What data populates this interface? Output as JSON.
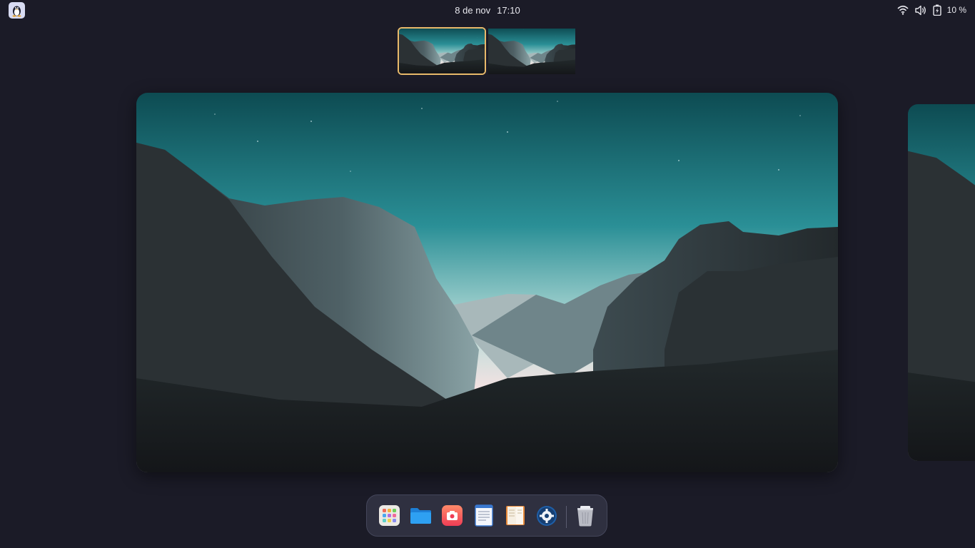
{
  "panel": {
    "distro_icon": "linux-penguin-icon",
    "date": "8 de nov",
    "time": "17:10",
    "tray": {
      "wifi_icon": "wifi-icon",
      "volume_icon": "volume-icon",
      "battery_icon": "battery-charging-icon",
      "battery_percent": "10 %"
    }
  },
  "workspaces": {
    "count": 2,
    "active_index": 0,
    "thumbnails": [
      {
        "name": "workspace-1",
        "active": true
      },
      {
        "name": "workspace-2",
        "active": false
      }
    ]
  },
  "dock": {
    "apps": [
      {
        "name": "app-grid",
        "icon": "app-grid-icon"
      },
      {
        "name": "files",
        "icon": "folder-icon"
      },
      {
        "name": "screenshot",
        "icon": "camera-icon"
      },
      {
        "name": "text-editor",
        "icon": "document-icon"
      },
      {
        "name": "reader",
        "icon": "book-icon"
      },
      {
        "name": "settings",
        "icon": "settings-gear-icon"
      }
    ],
    "trash_icon": "trash-icon"
  },
  "colors": {
    "background": "#1b1b27",
    "active_workspace_border": "#e8b96a",
    "dock_background": "#2f3040",
    "sky_top": "#0e4e55",
    "sky_horizon": "#f2dede"
  }
}
